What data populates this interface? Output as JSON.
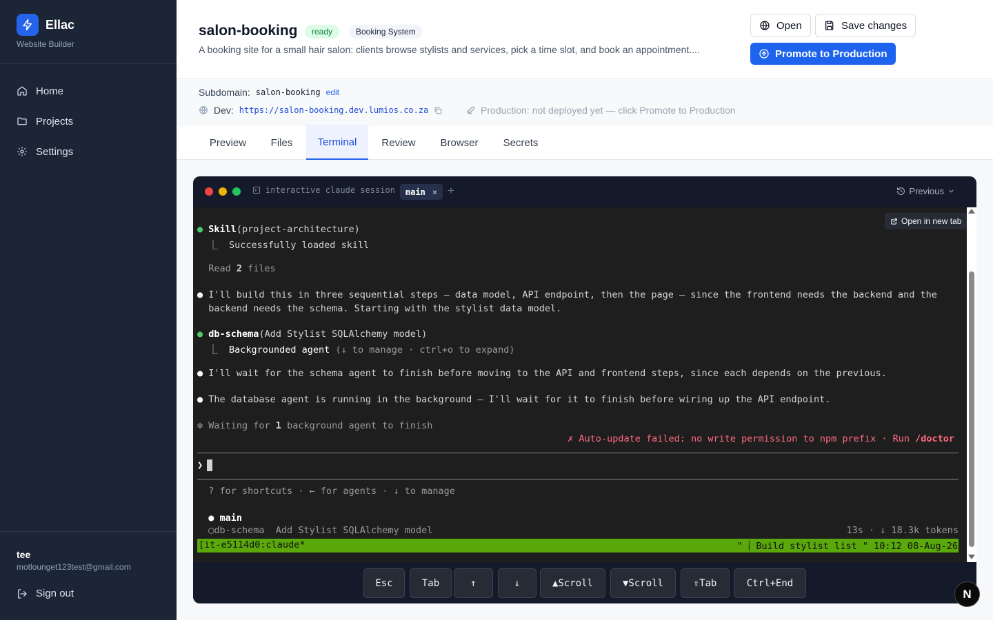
{
  "sidebar": {
    "brand_name": "Ellac",
    "brand_sub": "Website Builder",
    "items": [
      {
        "label": "Home",
        "icon": "home-icon"
      },
      {
        "label": "Projects",
        "icon": "folder-icon"
      },
      {
        "label": "Settings",
        "icon": "gear-icon"
      }
    ],
    "user_name": "tee",
    "user_email": "motlounget123test@gmail.com",
    "signout_label": "Sign out"
  },
  "header": {
    "title": "salon-booking",
    "status_badge": "ready",
    "type_badge": "Booking System",
    "description": "A booking site for a small hair salon: clients browse stylists and services, pick a time slot, and book an appointment....",
    "open_label": "Open",
    "save_label": "Save changes",
    "promote_label": "Promote to Production"
  },
  "info": {
    "subdomain_label": "Subdomain:",
    "subdomain_value": "salon-booking",
    "edit_label": "edit",
    "dev_label": "Dev:",
    "dev_url": "https://salon-booking.dev.lumios.co.za",
    "production_text": "Production: not deployed yet — click Promote to Production"
  },
  "tabs": [
    "Preview",
    "Files",
    "Terminal",
    "Review",
    "Browser",
    "Secrets"
  ],
  "active_tab": "Terminal",
  "terminal": {
    "session_label": "interactive claude session",
    "tab_name": "main",
    "tab_close": "×",
    "new_tab": "+",
    "previous_label": "Previous",
    "open_new_tab_label": "Open in new tab",
    "lines": {
      "skill_name": "Skill",
      "skill_arg": "(project-architecture)",
      "skill_result": "  ⎿  Successfully loaded skill",
      "read_files_pre": "  Read ",
      "read_files_count": "2",
      "read_files_post": " files",
      "plan_1": " I'll build this in three sequential steps — data model, API endpoint, then the page — since the frontend needs the backend and the",
      "plan_2": "  backend needs the schema. Starting with the stylist data model.",
      "agent_name": "db-schema",
      "agent_arg": "(Add Stylist SQLAlchemy model)",
      "agent_result_pre": "  ⎿  ",
      "agent_result_bold": "Backgrounded agent",
      "agent_result_hint": " (↓ to manage · ctrl+o to expand)",
      "wait_1": " I'll wait for the schema agent to finish before moving to the API and frontend steps, since each depends on the previous.",
      "wait_2": " The database agent is running in the background — I'll wait for it to finish before wiring up the API endpoint.",
      "waiting_pre": "✻ Waiting for ",
      "waiting_count": "1",
      "waiting_post": " background agent to finish",
      "error_text": "✗ Auto-update failed: no write permission to npm prefix · Run ",
      "error_cmd": "/doctor",
      "prompt": "❯",
      "shortcuts": "  ? for shortcuts · ← for agents · ↓ to manage",
      "agent_main": "main",
      "agent_bg_name": "db-schema",
      "agent_bg_desc": "  Add Stylist SQLAlchemy model",
      "agent_bg_stats": "13s · ↓ 18.3k tokens",
      "status_left": "[it-e5114d0:claude*",
      "status_right": "\" ⸽ Build stylist list \" 10:12 08-Aug-26"
    },
    "keys": [
      "Esc",
      "Tab",
      "↑",
      "↓",
      "▲Scroll",
      "▼Scroll",
      "⇧Tab",
      "Ctrl+End"
    ]
  },
  "corner_badge": "N",
  "colors": {
    "sidebar_bg": "#1c2536",
    "accent": "#1d63ed",
    "terminal_bg": "#1e1e1e",
    "status_bar": "#5aa80a",
    "error": "#ff6b81"
  }
}
